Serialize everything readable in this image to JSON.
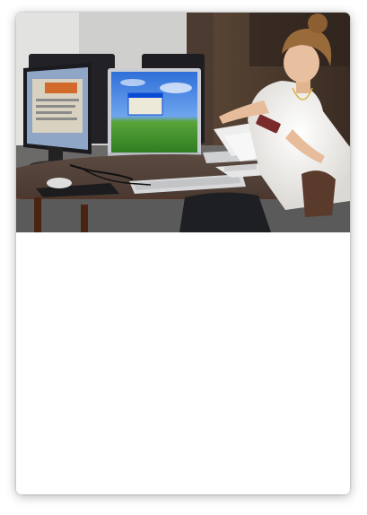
{
  "card": {
    "image": {
      "alt": "",
      "colors": {
        "wall": "#cfd0cf",
        "table_top": "#6a2e15",
        "table_edge": "#8b4720",
        "monitor": "#1e1e22",
        "xp_sky": "#3f7fe0",
        "xp_grass": "#3f9a2c",
        "blouse": "#f3f1ee",
        "hair": "#9a6b3a",
        "skin": "#e7bc9a"
      }
    }
  }
}
